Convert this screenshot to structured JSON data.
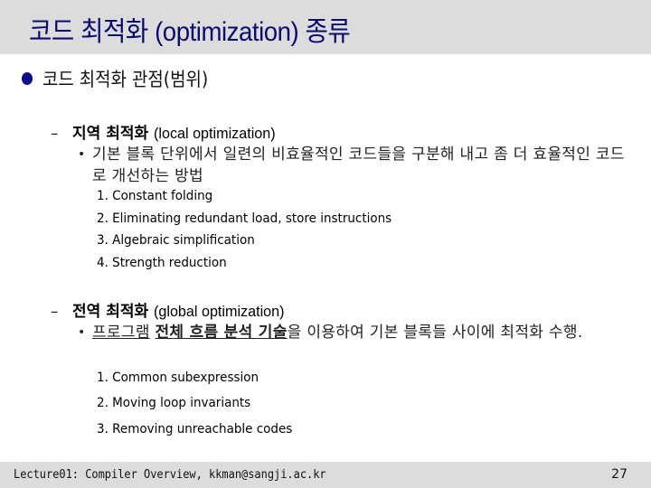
{
  "slide": {
    "title": "코드 최적화 (optimization) 종류",
    "bullet1": "코드 최적화 관점(범위)",
    "local": {
      "dash": "–",
      "heading_bold": "지역 최적화",
      "heading_paren": "(local optimization)",
      "desc_bullet": "•",
      "desc": "기본 블록 단위에서 일련의 비효율적인 코드들을 구분해 내고 좀 더 효율적인 코드로 개선하는 방법",
      "items": [
        "1. Constant folding",
        "2. Eliminating redundant load, store instructions",
        "3. Algebraic simplification",
        "4. Strength reduction"
      ]
    },
    "global": {
      "dash": "–",
      "heading_bold": "전역 최적화",
      "heading_paren": "(global optimization)",
      "desc_bullet": "•",
      "desc_part1": "프로그램",
      "desc_bold": "전체 흐름 분석 기술",
      "desc_part2": "을 이용하여 기본 블록들 사이에 최적화 수행.",
      "items": [
        "1. Common subexpression",
        "2. Moving loop invariants",
        "3. Removing unreachable codes"
      ]
    }
  },
  "footer": {
    "text": "Lecture01: Compiler Overview, kkman@sangji.ac.kr",
    "page": "27"
  },
  "colors": {
    "title": "#0b0b6e",
    "bar": "#dcdcdc",
    "bullet": "#0d0d8a"
  }
}
